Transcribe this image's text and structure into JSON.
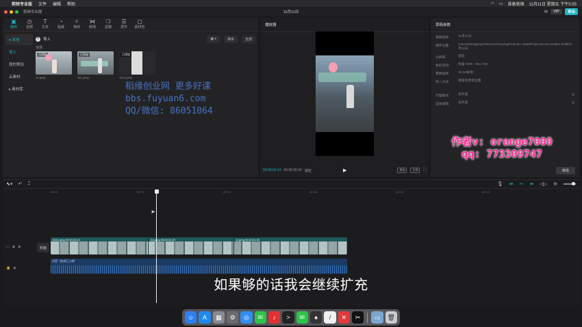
{
  "menubar": {
    "app_name": "剪映专业版",
    "items": [
      "文件",
      "编辑",
      "帮助"
    ],
    "status_text": "准备就绪",
    "clock": "11月11日 星期五 下午5:55",
    "colors": {
      "bg": "#2b2b2d"
    }
  },
  "titlebar": {
    "left_text": "剪映专业版",
    "title": "11月11日",
    "vip": "VIP",
    "export": "导出"
  },
  "toolbar": {
    "tabs": [
      {
        "label": "媒体",
        "icon": "media-icon"
      },
      {
        "label": "音频",
        "icon": "audio-icon"
      },
      {
        "label": "文本",
        "icon": "text-icon"
      },
      {
        "label": "贴纸",
        "icon": "sticker-icon"
      },
      {
        "label": "特效",
        "icon": "effects-icon"
      },
      {
        "label": "转场",
        "icon": "transition-icon"
      },
      {
        "label": "滤镜",
        "icon": "filter-icon"
      },
      {
        "label": "调节",
        "icon": "adjust-icon"
      },
      {
        "label": "素材包",
        "icon": "pack-icon"
      }
    ]
  },
  "side_nav": {
    "local": "▾ 本地",
    "import": "导入",
    "presets": "我的预设",
    "library": "云素材",
    "material_lib": "▸ 素材库"
  },
  "media": {
    "import_label": "导入",
    "section_label": "全部",
    "sort_label": "排序",
    "all_label": "全部",
    "thumb_tag": "已添加",
    "items": [
      {
        "name": "11.jpeg"
      },
      {
        "name": "111.jpeg"
      },
      {
        "name": "1111.jpeg"
      }
    ]
  },
  "watermark": {
    "line1": "稻缘创业网 更多好课",
    "line2": "bbs.fuyuan6.com",
    "line3": "QQ/微信: 86051064"
  },
  "player": {
    "title": "播放器",
    "time_current": "00:00:02:14",
    "time_total": "00:00:06:24",
    "mode": "适应",
    "chip1": "原始",
    "chip2": "比例"
  },
  "props": {
    "title": "草稿参数",
    "rows": [
      {
        "k": "草稿名称:",
        "v": "11月11日"
      },
      {
        "k": "保存位置:",
        "v": "/Users/wangjunjie/Movies/JianyingPro/User Data/Projects/com.lveditor.draft/11月11日"
      },
      {
        "k": "分辨率:",
        "v": "适应"
      },
      {
        "k": "色彩空间:",
        "v": "标准 SDR - Rec.709"
      },
      {
        "k": "草稿帧率:",
        "v": "30.00帧/秒"
      },
      {
        "k": "导入方式:",
        "v": "保留在原有位置"
      },
      {
        "k": "代理模式:",
        "v": "未开启"
      },
      {
        "k": "自由层级:",
        "v": "未开启"
      }
    ],
    "modify": "修改"
  },
  "author": {
    "line1": "作者v: orange7000",
    "line2": "qq: 773309747"
  },
  "timeline": {
    "cover_label": "封面",
    "ruler": [
      "00:00",
      "|00:02",
      "|00:04",
      "|00:06",
      "|00:08",
      "|00:10"
    ],
    "clips": [
      {
        "label": "11111.jpeg  00:00:02:02"
      },
      {
        "label": "111.jpeg  00:00:01:29"
      },
      {
        "label": "11.jpeg  00:00:01:30"
      }
    ],
    "audio_label": "抖音（合成已上线）"
  },
  "subtitle": "如果够的话我会继续扩充",
  "dock": {
    "apps": [
      {
        "name": "finder-icon",
        "color": "#2d7ff0",
        "glyph": "☺"
      },
      {
        "name": "app-store-icon",
        "color": "#1d8bf0",
        "glyph": "A"
      },
      {
        "name": "launchpad-icon",
        "color": "#8a8a95",
        "glyph": "▦"
      },
      {
        "name": "system-prefs-icon",
        "color": "#6b6b70",
        "glyph": "⚙"
      },
      {
        "name": "safari-icon",
        "color": "#2f8ef5",
        "glyph": "◎"
      },
      {
        "name": "wechat-icon",
        "color": "#2dc44b",
        "glyph": "✉"
      },
      {
        "name": "netease-music-icon",
        "color": "#e43030",
        "glyph": "♪"
      },
      {
        "name": "terminal-icon",
        "color": "#222",
        "glyph": ">"
      },
      {
        "name": "wechat2-icon",
        "color": "#2dc44b",
        "glyph": "✉"
      },
      {
        "name": "cards-icon",
        "color": "#333",
        "glyph": "♠"
      },
      {
        "name": "notes-icon",
        "color": "#f0f0f0",
        "glyph": "/"
      },
      {
        "name": "xmind-icon",
        "color": "#e23a3a",
        "glyph": "✕"
      },
      {
        "name": "capcut-icon",
        "color": "#111",
        "glyph": "✂"
      },
      {
        "name": "preview-icon",
        "color": "#7aa6d0",
        "glyph": "▭"
      },
      {
        "name": "trash-icon",
        "color": "#c9ccd0",
        "glyph": "🗑"
      }
    ]
  }
}
